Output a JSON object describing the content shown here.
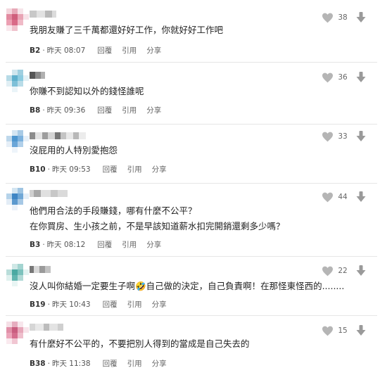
{
  "actions": {
    "reply": "回覆",
    "quote": "引用",
    "share": "分享"
  },
  "colors": {
    "heart": "#b5b5b5",
    "down_arrow": "#9a9a9a",
    "separator": "#e6e6e6"
  },
  "icons": {
    "like": "heart-icon",
    "dislike": "down-arrow-icon"
  },
  "comments": [
    {
      "floor": "B2",
      "time": "昨天 08:07",
      "likes": "38",
      "lines": [
        "我朋友賺了三千萬都還好好工作，你就好好工作吧"
      ]
    },
    {
      "floor": "B8",
      "time": "昨天 09:36",
      "likes": "36",
      "lines": [
        "你賺不到認知以外的錢怪誰呢"
      ]
    },
    {
      "floor": "B10",
      "time": "昨天 09:53",
      "likes": "33",
      "lines": [
        "沒屁用的人特別愛抱怨"
      ]
    },
    {
      "floor": "B3",
      "time": "昨天 08:12",
      "likes": "44",
      "lines": [
        "他們用合法的手段賺錢，哪有什麼不公平？",
        "在你買房、生小孩之前，不是早該知道薪水扣完開銷還剩多少嗎？"
      ]
    },
    {
      "floor": "B19",
      "time": "昨天 10:43",
      "likes": "22",
      "lines": [
        "沒人叫你結婚一定要生子啊🤣自己做的決定，自己負責啊！在那怪東怪西的........"
      ]
    },
    {
      "floor": "B38",
      "time": "昨天 11:38",
      "likes": "15",
      "lines": [
        "有什麼好不公平的，不要把別人得到的當成是自己失去的"
      ]
    }
  ]
}
